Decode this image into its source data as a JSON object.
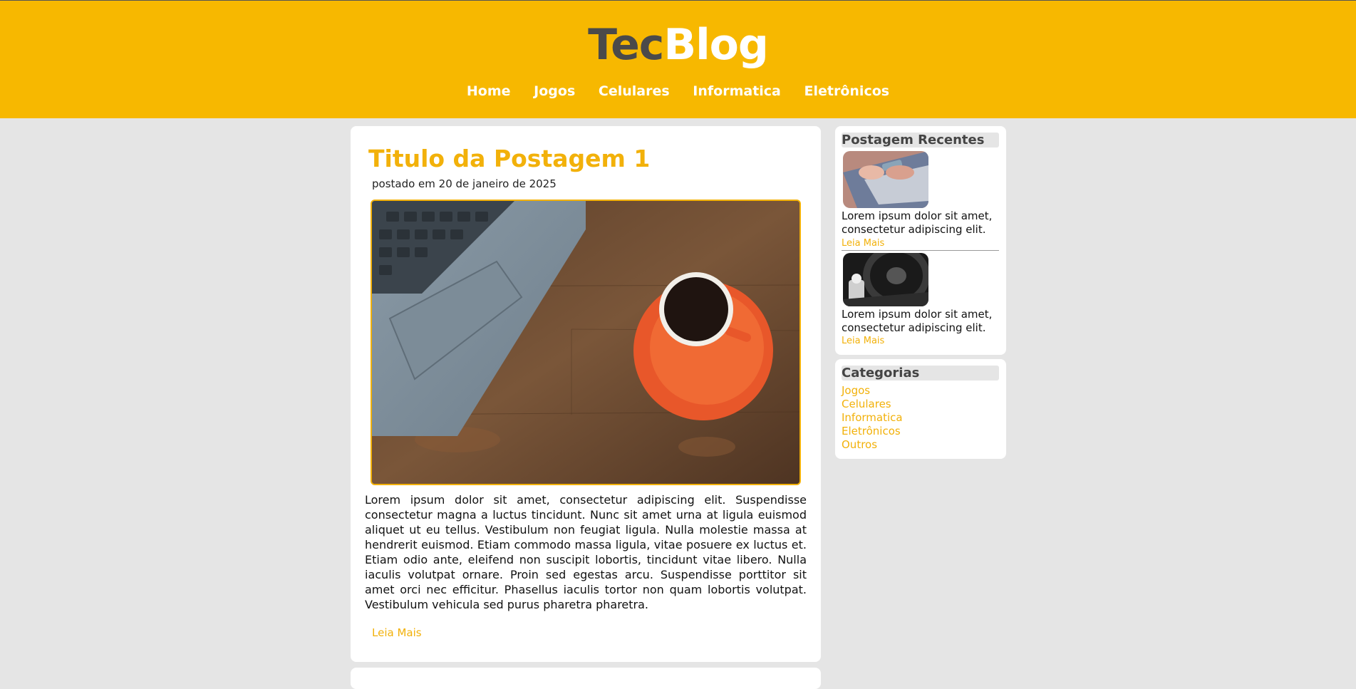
{
  "header": {
    "logo_part1": "Tec",
    "logo_part2": "Blog",
    "nav": [
      "Home",
      "Jogos",
      "Celulares",
      "Informatica",
      "Eletrônicos"
    ]
  },
  "post": {
    "title": "Titulo da Postagem 1",
    "date": "postado em 20 de janeiro de 2025",
    "text": "Lorem ipsum dolor sit amet, consectetur adipiscing elit. Suspendisse consectetur magna a luctus tincidunt. Nunc sit amet urna at ligula euismod aliquet ut eu tellus. Vestibulum non feugiat ligula. Nulla molestie massa at hendrerit euismod. Etiam commodo massa ligula, vitae posuere ex luctus et. Etiam odio ante, eleifend non suscipit lobortis, tincidunt vitae libero. Nulla iaculis volutpat ornare. Proin sed egestas arcu. Suspendisse porttitor sit amet orci nec efficitur. Phasellus iaculis tortor non quam lobortis volutpat. Vestibulum vehicula sed purus pharetra pharetra.",
    "more": "Leia Mais"
  },
  "recent": {
    "title": "Postagem Recentes",
    "items": [
      {
        "text": "Lorem ipsum dolor sit amet, consectetur adipiscing elit.",
        "more": "Leia Mais"
      },
      {
        "text": "Lorem ipsum dolor sit amet, consectetur adipiscing elit.",
        "more": "Leia Mais"
      }
    ]
  },
  "categories": {
    "title": "Categorias",
    "items": [
      "Jogos",
      "Celulares",
      "Informatica",
      "Eletrônicos",
      "Outros"
    ]
  },
  "colors": {
    "brand": "#f7b800",
    "accent": "#f2b10a",
    "background": "#e5e5e5"
  }
}
